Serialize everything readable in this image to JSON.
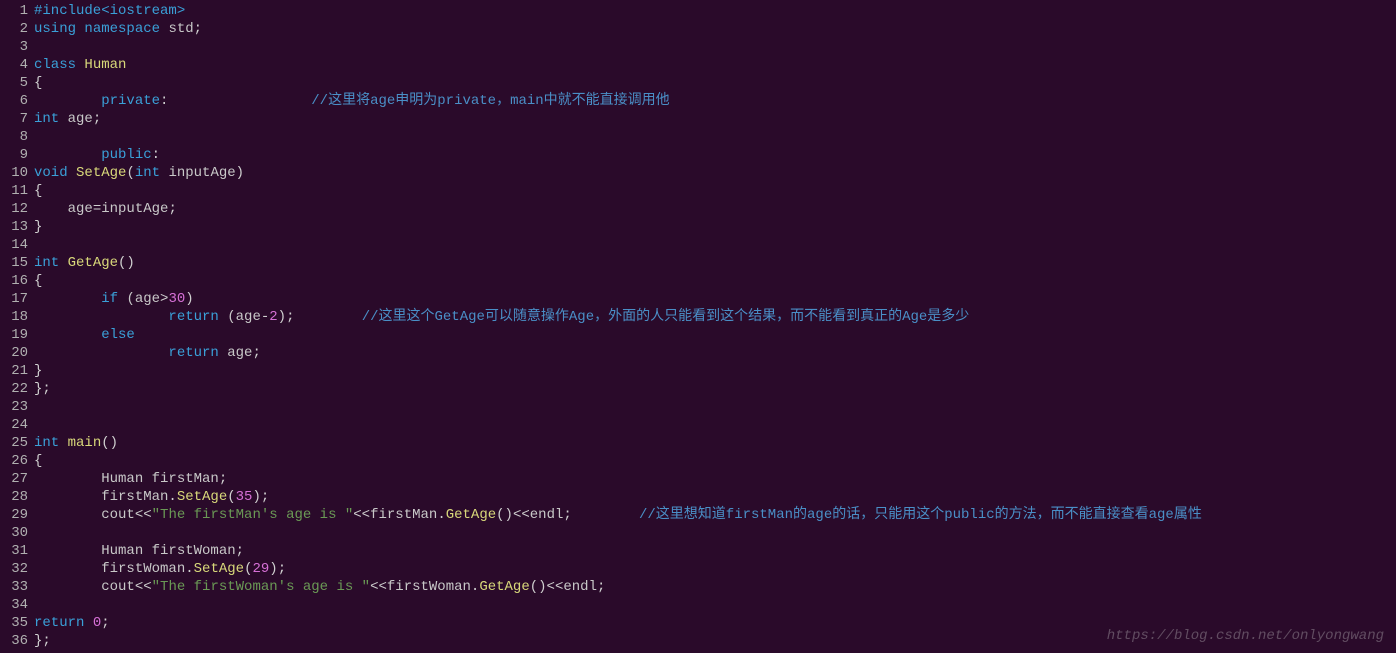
{
  "watermark": "https://blog.csdn.net/onlyongwang",
  "lines": [
    {
      "num": "1",
      "tokens": [
        [
          "#include",
          "kw"
        ],
        [
          "<iostream>",
          "type"
        ]
      ]
    },
    {
      "num": "2",
      "tokens": [
        [
          "using ",
          "kw"
        ],
        [
          "namespace ",
          "kw"
        ],
        [
          "std",
          "ident"
        ],
        [
          ";",
          "punct"
        ]
      ]
    },
    {
      "num": "3",
      "tokens": [
        [
          "",
          "punct"
        ]
      ]
    },
    {
      "num": "4",
      "tokens": [
        [
          "class ",
          "kw"
        ],
        [
          "Human",
          "fn"
        ]
      ]
    },
    {
      "num": "5",
      "tokens": [
        [
          "{",
          "punct"
        ]
      ]
    },
    {
      "num": "6",
      "tokens": [
        [
          "        ",
          "punct"
        ],
        [
          "private",
          "kw"
        ],
        [
          ":",
          "punct"
        ],
        [
          "                 ",
          "punct"
        ],
        [
          "//这里将age申明为private，main中就不能直接调用他",
          "cmt"
        ]
      ]
    },
    {
      "num": "7",
      "tokens": [
        [
          "int ",
          "type"
        ],
        [
          "age",
          "ident"
        ],
        [
          ";",
          "punct"
        ]
      ]
    },
    {
      "num": "8",
      "tokens": [
        [
          "",
          "punct"
        ]
      ]
    },
    {
      "num": "9",
      "tokens": [
        [
          "        ",
          "punct"
        ],
        [
          "public",
          "kw"
        ],
        [
          ":",
          "punct"
        ]
      ]
    },
    {
      "num": "10",
      "tokens": [
        [
          "void ",
          "type"
        ],
        [
          "SetAge",
          "fn"
        ],
        [
          "(",
          "punct"
        ],
        [
          "int ",
          "type"
        ],
        [
          "inputAge",
          "ident"
        ],
        [
          ")",
          "punct"
        ]
      ]
    },
    {
      "num": "11",
      "tokens": [
        [
          "{",
          "punct"
        ]
      ]
    },
    {
      "num": "12",
      "tokens": [
        [
          "    age",
          "ident"
        ],
        [
          "=",
          "op"
        ],
        [
          "inputAge",
          "ident"
        ],
        [
          ";",
          "punct"
        ]
      ]
    },
    {
      "num": "13",
      "tokens": [
        [
          "}",
          "punct"
        ]
      ]
    },
    {
      "num": "14",
      "tokens": [
        [
          "",
          "punct"
        ]
      ]
    },
    {
      "num": "15",
      "tokens": [
        [
          "int ",
          "type"
        ],
        [
          "GetAge",
          "fn"
        ],
        [
          "()",
          "punct"
        ]
      ]
    },
    {
      "num": "16",
      "tokens": [
        [
          "{",
          "punct"
        ]
      ]
    },
    {
      "num": "17",
      "tokens": [
        [
          "        ",
          "punct"
        ],
        [
          "if ",
          "kw"
        ],
        [
          "(age",
          "ident"
        ],
        [
          ">",
          "op"
        ],
        [
          "30",
          "num"
        ],
        [
          ")",
          "punct"
        ]
      ]
    },
    {
      "num": "18",
      "tokens": [
        [
          "                ",
          "punct"
        ],
        [
          "return ",
          "kw"
        ],
        [
          "(age",
          "ident"
        ],
        [
          "-",
          "op"
        ],
        [
          "2",
          "num"
        ],
        [
          ")",
          "punct"
        ],
        [
          ";",
          "punct"
        ],
        [
          "        ",
          "punct"
        ],
        [
          "//这里这个GetAge可以随意操作Age，外面的人只能看到这个结果，而不能看到真正的Age是多少",
          "cmt"
        ]
      ]
    },
    {
      "num": "19",
      "tokens": [
        [
          "        ",
          "punct"
        ],
        [
          "else",
          "kw"
        ]
      ]
    },
    {
      "num": "20",
      "tokens": [
        [
          "                ",
          "punct"
        ],
        [
          "return ",
          "kw"
        ],
        [
          "age",
          "ident"
        ],
        [
          ";",
          "punct"
        ]
      ]
    },
    {
      "num": "21",
      "tokens": [
        [
          "}",
          "punct"
        ]
      ]
    },
    {
      "num": "22",
      "tokens": [
        [
          "};",
          "punct"
        ]
      ]
    },
    {
      "num": "23",
      "tokens": [
        [
          "",
          "punct"
        ]
      ]
    },
    {
      "num": "24",
      "tokens": [
        [
          "",
          "punct"
        ]
      ]
    },
    {
      "num": "25",
      "tokens": [
        [
          "int ",
          "type"
        ],
        [
          "main",
          "fn"
        ],
        [
          "()",
          "punct"
        ]
      ]
    },
    {
      "num": "26",
      "tokens": [
        [
          "{",
          "punct"
        ]
      ]
    },
    {
      "num": "27",
      "tokens": [
        [
          "        Human firstMan",
          "ident"
        ],
        [
          ";",
          "punct"
        ]
      ]
    },
    {
      "num": "28",
      "tokens": [
        [
          "        firstMan",
          "ident"
        ],
        [
          ".",
          "punct"
        ],
        [
          "SetAge",
          "fn"
        ],
        [
          "(",
          "punct"
        ],
        [
          "35",
          "num"
        ],
        [
          ")",
          "punct"
        ],
        [
          ";",
          "punct"
        ]
      ]
    },
    {
      "num": "29",
      "tokens": [
        [
          "        cout",
          "ident"
        ],
        [
          "<<",
          "op"
        ],
        [
          "\"The firstMan's age is \"",
          "str"
        ],
        [
          "<<",
          "op"
        ],
        [
          "firstMan",
          "ident"
        ],
        [
          ".",
          "punct"
        ],
        [
          "GetAge",
          "fn"
        ],
        [
          "()",
          "punct"
        ],
        [
          "<<",
          "op"
        ],
        [
          "endl",
          "ident"
        ],
        [
          ";",
          "punct"
        ],
        [
          "        ",
          "punct"
        ],
        [
          "//这里想知道firstMan的age的话，只能用这个public的方法，而不能直接查看age属性",
          "cmt"
        ]
      ]
    },
    {
      "num": "30",
      "tokens": [
        [
          "",
          "punct"
        ]
      ]
    },
    {
      "num": "31",
      "tokens": [
        [
          "        Human firstWoman",
          "ident"
        ],
        [
          ";",
          "punct"
        ]
      ]
    },
    {
      "num": "32",
      "tokens": [
        [
          "        firstWoman",
          "ident"
        ],
        [
          ".",
          "punct"
        ],
        [
          "SetAge",
          "fn"
        ],
        [
          "(",
          "punct"
        ],
        [
          "29",
          "num"
        ],
        [
          ")",
          "punct"
        ],
        [
          ";",
          "punct"
        ]
      ]
    },
    {
      "num": "33",
      "tokens": [
        [
          "        cout",
          "ident"
        ],
        [
          "<<",
          "op"
        ],
        [
          "\"The firstWoman's age is \"",
          "str"
        ],
        [
          "<<",
          "op"
        ],
        [
          "firstWoman",
          "ident"
        ],
        [
          ".",
          "punct"
        ],
        [
          "GetAge",
          "fn"
        ],
        [
          "()",
          "punct"
        ],
        [
          "<<",
          "op"
        ],
        [
          "endl",
          "ident"
        ],
        [
          ";",
          "punct"
        ]
      ]
    },
    {
      "num": "34",
      "tokens": [
        [
          "",
          "punct"
        ]
      ]
    },
    {
      "num": "35",
      "tokens": [
        [
          "return ",
          "kw"
        ],
        [
          "0",
          "num"
        ],
        [
          ";",
          "punct"
        ]
      ]
    },
    {
      "num": "36",
      "tokens": [
        [
          "};",
          "punct"
        ]
      ]
    }
  ]
}
